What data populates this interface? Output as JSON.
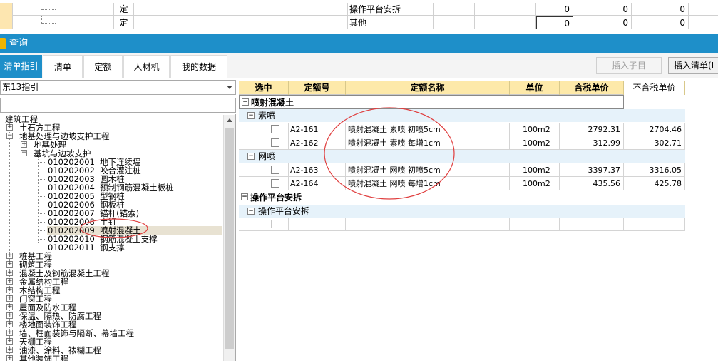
{
  "top_grid": {
    "rows": [
      {
        "type": "定",
        "name": "操作平台安拆",
        "v1": "0",
        "v2": "0",
        "v3": "0"
      },
      {
        "type": "定",
        "name": "其他",
        "v1": "0",
        "v2": "0",
        "v3": "0"
      }
    ]
  },
  "query_bar": {
    "title": "查询",
    "icon": "query-icon"
  },
  "tabs": [
    {
      "label": "清单指引",
      "active": true
    },
    {
      "label": "清单"
    },
    {
      "label": "定额"
    },
    {
      "label": "人材机"
    },
    {
      "label": "我的数据"
    }
  ],
  "toolbar": {
    "insert_child": "插入子目",
    "insert_list": "插入清单(I"
  },
  "guide": {
    "selected": "东13指引"
  },
  "tree": {
    "items": [
      {
        "label": "建筑工程"
      },
      {
        "label": "土石方工程"
      },
      {
        "label": "地基处理与边坡支护工程"
      },
      {
        "label": "地基处理"
      },
      {
        "label": "基坑与边坡支护"
      },
      {
        "code": "010202001",
        "label": "地下连续墙"
      },
      {
        "code": "010202002",
        "label": "咬合灌注桩"
      },
      {
        "code": "010202003",
        "label": "圆木桩"
      },
      {
        "code": "010202004",
        "label": "预制钢筋混凝土板桩"
      },
      {
        "code": "010202005",
        "label": "型钢桩"
      },
      {
        "code": "010202006",
        "label": "钢板桩"
      },
      {
        "code": "010202007",
        "label": "锚杆(锚索)"
      },
      {
        "code": "010202008",
        "label": "土钉"
      },
      {
        "code": "010202009",
        "label": "喷射混凝土"
      },
      {
        "code": "010202010",
        "label": "钢筋混凝土支撑"
      },
      {
        "code": "010202011",
        "label": "钢支撑"
      },
      {
        "label": "桩基工程"
      },
      {
        "label": "砌筑工程"
      },
      {
        "label": "混凝土及钢筋混凝土工程"
      },
      {
        "label": "金属结构工程"
      },
      {
        "label": "木结构工程"
      },
      {
        "label": "门窗工程"
      },
      {
        "label": "屋面及防水工程"
      },
      {
        "label": "保温、隔热、防腐工程"
      },
      {
        "label": "楼地面装饰工程"
      },
      {
        "label": "墙、柱面装饰与隔断、幕墙工程"
      },
      {
        "label": "天棚工程"
      },
      {
        "label": "油漆、涂料、裱糊工程"
      },
      {
        "label": "其他装饰工程"
      }
    ]
  },
  "grid": {
    "headers": {
      "select": "选中",
      "code": "定额号",
      "name": "定额名称",
      "unit": "单位",
      "price_tax": "含税单价",
      "price_notax": "不含税单价"
    },
    "group1": "喷射混凝土",
    "sub1": "素喷",
    "rows1": [
      {
        "code": "A2-161",
        "name": "喷射混凝土 素喷 初喷5cm",
        "unit": "100m2",
        "price_tax": "2792.31",
        "price_notax": "2704.46"
      },
      {
        "code": "A2-162",
        "name": "喷射混凝土 素喷 每增1cm",
        "unit": "100m2",
        "price_tax": "312.99",
        "price_notax": "302.71"
      }
    ],
    "sub2": "网喷",
    "rows2": [
      {
        "code": "A2-163",
        "name": "喷射混凝土 网喷 初喷5cm",
        "unit": "100m2",
        "price_tax": "3397.37",
        "price_notax": "3316.05"
      },
      {
        "code": "A2-164",
        "name": "喷射混凝土 网喷 每增1cm",
        "unit": "100m2",
        "price_tax": "435.56",
        "price_notax": "425.78"
      }
    ],
    "group2": "操作平台安拆",
    "sub3": "操作平台安拆"
  },
  "colors": {
    "accent": "#1e8fc9",
    "header_bg": "#fde9a9",
    "subgroup_bg": "#e6f2fa",
    "annotation": "#e04040"
  }
}
